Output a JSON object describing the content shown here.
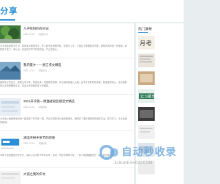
{
  "header": {
    "title": "分享"
  },
  "posts": [
    {
      "tag": "",
      "title": "儿子给妈妈的日记",
      "date": "2022-12-13",
      "views": "阅读(114)",
      "excerpt": "今天我给妈妈写日记，妈妈每天都很辛苦，早上起来给我做早饭，送我去上学，下班后又要做饭洗衣服，我想对妈妈说一声谢谢，妈妈您辛苦了，我以后一定会好好学习听您的话，不让您操心。"
    },
    {
      "tag": "",
      "title": "我的家乡——浙江作文精选",
      "date": "2022-12-13",
      "views": "阅读(74)",
      "excerpt": "我的家乡在浙江，那里山清水秀，风景优美，有美丽的西湖，有壮观的钱塘江大潮，还有许多好吃的美食，我爱我的家乡，我为我的家乡感到骄傲和自豪，欢迎大家到我的家乡来做客。"
    },
    {
      "tag": "",
      "title": "2022开学第一课直播观后感范文精选",
      "date": "2022-12-13",
      "views": "阅读(85)",
      "excerpt": "今天晚上我和爸爸妈妈一起观看了开学第一课，节目中的故事让我深受感动，我明白了要珍惜现在的美好生活，努力学习，长大后报效祖国。"
    },
    {
      "tag": "",
      "title": "湖北庆祝中秋节的风俗",
      "date": "2022-12-13",
      "views": "阅读(62)",
      "excerpt": "中秋节是我国的传统节日，湖北人过中秋节有吃月饼、赏月、吃桂花鸭等习俗，一家人团团圆圆坐在一起，其乐融融。"
    },
    {
      "tag": "",
      "title": "大道之我的作文",
      "date": "",
      "views": "",
      "excerpt": ""
    }
  ],
  "sidebar": {
    "heading": "热门推荐",
    "items": [
      {
        "text": ""
      },
      {
        "text": ""
      },
      {
        "text": ""
      },
      {
        "text": ""
      },
      {
        "text": ""
      },
      {
        "text": ""
      },
      {
        "text": ""
      },
      {
        "text": ""
      }
    ]
  },
  "watermark": {
    "name": "自动秒收录",
    "sub": "JUBUKESHOU.COM"
  },
  "colors": {
    "accent": "#2a8fd4",
    "background": "#e8edf0"
  }
}
